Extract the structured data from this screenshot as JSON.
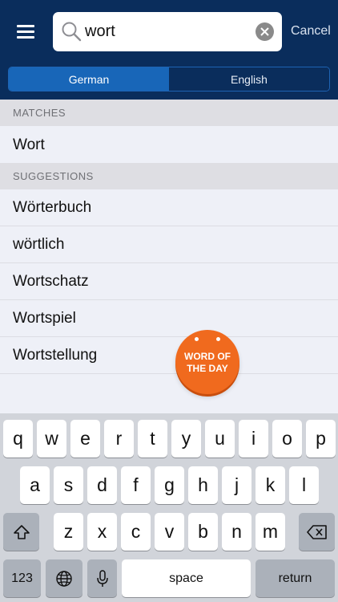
{
  "search": {
    "value": "wort",
    "cancel_label": "Cancel"
  },
  "language_tabs": [
    {
      "label": "German",
      "selected": true
    },
    {
      "label": "English",
      "selected": false
    }
  ],
  "sections": {
    "matches": {
      "title": "MATCHES",
      "items": [
        "Wort"
      ]
    },
    "suggestions": {
      "title": "SUGGESTIONS",
      "items": [
        "Wörterbuch",
        "wörtlich",
        "Wortschatz",
        "Wortspiel",
        "Wortstellung"
      ]
    }
  },
  "word_of_day": {
    "line1": "WORD OF",
    "line2": "THE DAY",
    "color": "#f06a1e"
  },
  "keyboard": {
    "row1": [
      "q",
      "w",
      "e",
      "r",
      "t",
      "y",
      "u",
      "i",
      "o",
      "p"
    ],
    "row2": [
      "a",
      "s",
      "d",
      "f",
      "g",
      "h",
      "j",
      "k",
      "l"
    ],
    "row3": [
      "z",
      "x",
      "c",
      "v",
      "b",
      "n",
      "m"
    ],
    "numbers_label": "123",
    "space_label": "space",
    "return_label": "return"
  },
  "colors": {
    "header_bg": "#0a2d5c",
    "accent": "#1866b8"
  }
}
